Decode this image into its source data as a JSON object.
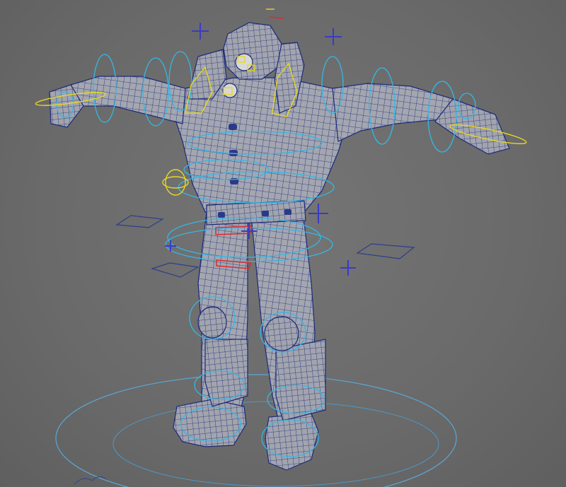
{
  "viewport": {
    "background": "#6d6d6d",
    "mesh_fill": "#a4a6b0",
    "wire_color": "#1c2a78",
    "ctrl_blue": "#33b8e6",
    "ctrl_yellow": "#e8d81e",
    "ctrl_red": "#e02a2a",
    "locator_color": "#3a3ac8"
  },
  "scene": {
    "character": "wireframe-character-mesh",
    "rig_controls": [
      "head-ctrl",
      "neck-ctrl",
      "shoulder-ctrls",
      "elbow-ctrls",
      "wrist-ctrls",
      "hand-ctrls",
      "chest-ctrls",
      "spine-ctrls",
      "hip-ctrls",
      "knee-ctrls",
      "ankle-ctrls",
      "foot-ctrls",
      "world-ctrl"
    ],
    "icons": [
      "locator-cross-icon",
      "pole-vector-icon"
    ]
  }
}
